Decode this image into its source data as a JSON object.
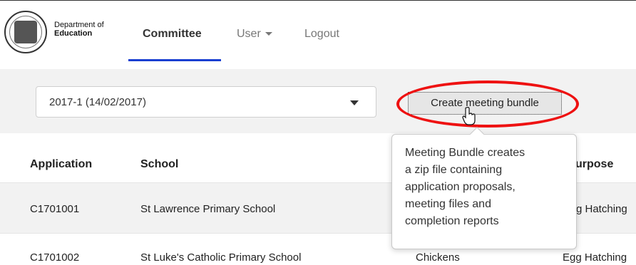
{
  "logo": {
    "line1": "Department of",
    "line2": "Education"
  },
  "nav": {
    "committee": "Committee",
    "user": "User",
    "logout": "Logout"
  },
  "toolbar": {
    "meeting_select": "2017-1 (14/02/2017)",
    "create_bundle_label": "Create meeting bundle",
    "tooltip_lines": [
      "Meeting Bundle creates",
      "a zip file containing",
      "application proposals,",
      "meeting files and",
      "completion reports"
    ]
  },
  "table": {
    "headers": {
      "application": "Application",
      "school": "School",
      "purpose": "urpose"
    },
    "rows": [
      {
        "application": "C1701001",
        "school": "St Lawrence Primary School",
        "project": "",
        "purpose": "g Hatching"
      },
      {
        "application": "C1701002",
        "school": "St Luke's Catholic Primary School",
        "project": "Chickens",
        "purpose": "Egg Hatching"
      }
    ]
  },
  "colors": {
    "accent": "#1a3fd1",
    "highlight": "#e11111"
  }
}
